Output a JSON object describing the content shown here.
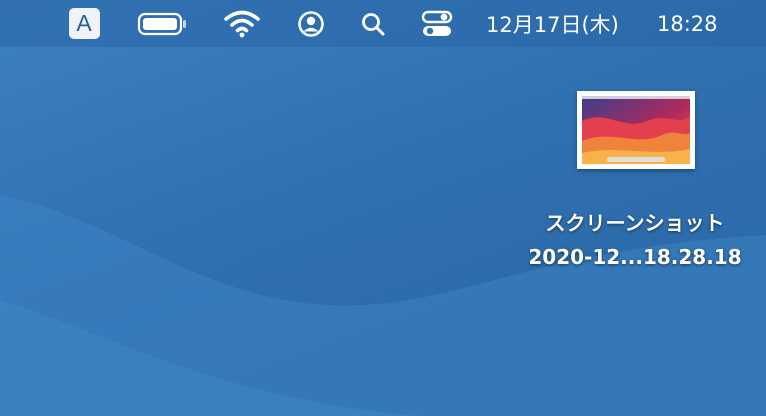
{
  "menubar": {
    "input_source": "A",
    "icons": [
      "battery-icon",
      "wifi-icon",
      "user-account-icon",
      "spotlight-search-icon",
      "control-center-icon"
    ],
    "clock": {
      "date": "12月17日(木)",
      "time": "18:28"
    }
  },
  "desktop": {
    "items": [
      {
        "name_line1": "スクリーンショット",
        "name_line2": "2020-12...18.28.18"
      }
    ]
  },
  "colors": {
    "desktop_background": "#2f70b0",
    "menubar_text": "#ffffff"
  }
}
